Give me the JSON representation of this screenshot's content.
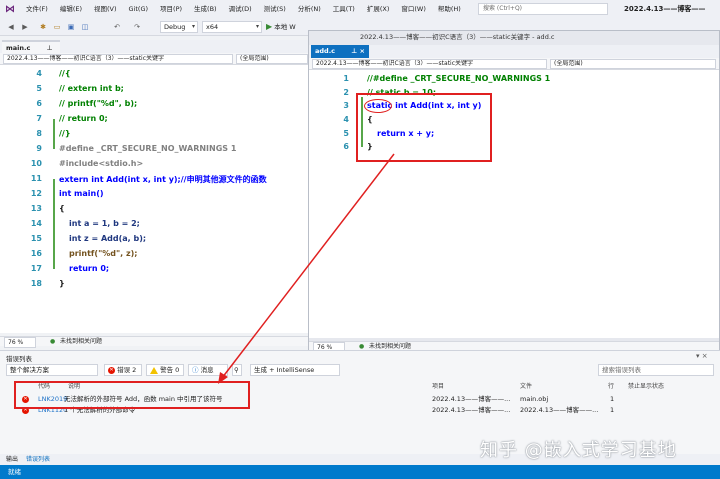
{
  "menu": {
    "items": [
      "文件(F)",
      "编辑(E)",
      "视图(V)",
      "Git(G)",
      "项目(P)",
      "生成(B)",
      "调试(D)",
      "测试(S)",
      "分析(N)",
      "工具(T)",
      "扩展(X)",
      "窗口(W)",
      "帮助(H)"
    ],
    "search_placeholder": "搜索 (Ctrl+Q)",
    "window_title": "2022.4.13——博客——"
  },
  "toolbar": {
    "config": "Debug",
    "platform": "x64",
    "run_label": "本地 W"
  },
  "left_editor": {
    "tab_label": "main.c",
    "tab_pin": "⊥",
    "tab_close": "×",
    "nav_left": "2022.4.13——博客——初识C语言（3）——static关键字",
    "nav_right": "(全局范围)",
    "lines": [
      {
        "n": "4",
        "text": "//{"
      },
      {
        "n": "5",
        "text": "// extern int b;"
      },
      {
        "n": "6",
        "text": "// printf(\"%d\", b);"
      },
      {
        "n": "7",
        "text": "// return 0;"
      },
      {
        "n": "8",
        "text": "//}"
      },
      {
        "n": "9",
        "text": "#define _CRT_SECURE_NO_WARNINGS 1"
      },
      {
        "n": "10",
        "text": "#include<stdio.h>"
      },
      {
        "n": "11",
        "text": "extern int Add(int x, int y);//申明其他源文件的函数"
      },
      {
        "n": "12",
        "text": "int main()"
      },
      {
        "n": "13",
        "text": "{"
      },
      {
        "n": "14",
        "text": "int a = 1, b = 2;"
      },
      {
        "n": "15",
        "text": "int z = Add(a, b);"
      },
      {
        "n": "16",
        "text": "printf(\"%d\", z);"
      },
      {
        "n": "17",
        "text": "return 0;"
      },
      {
        "n": "18",
        "text": "}"
      }
    ],
    "zoom": "76 %",
    "status": "未找到相关问题"
  },
  "right_editor": {
    "tab_label": "add.c",
    "tab_pin": "⊥",
    "tab_close": "×",
    "window_title": "2022.4.13——博客——初识C语言（3）——static关键字 - add.c",
    "nav_left": "2022.4.13——博客——初识C语言（3）——static关键字",
    "nav_right": "(全局范围)",
    "lines": [
      {
        "n": "1",
        "text": "//#define _CRT_SECURE_NO_WARNINGS 1"
      },
      {
        "n": "2",
        "text": "// static b = 10;"
      },
      {
        "n": "3",
        "text": "static int Add(int x, int y)"
      },
      {
        "n": "4",
        "text": "{"
      },
      {
        "n": "5",
        "text": "return x + y;"
      },
      {
        "n": "6",
        "text": "}"
      }
    ],
    "zoom": "76 %",
    "status": "未找到相关问题"
  },
  "error_list": {
    "title": "错误列表",
    "scope": "整个解决方案",
    "errors_btn": "错误 2",
    "warnings_btn": "警告 0",
    "messages_btn": "消息",
    "build_filter": "生成 + IntelliSense",
    "search_placeholder": "搜索错误列表",
    "headers": {
      "code": "代码",
      "desc": "说明",
      "project": "项目",
      "file": "文件",
      "line": "行",
      "suppress": "禁止显示状态"
    },
    "rows": [
      {
        "code": "LNK2019",
        "desc": "无法解析的外部符号 Add，函数 main 中引用了该符号",
        "project": "2022.4.13——博客——...",
        "file": "main.obj",
        "line": "1"
      },
      {
        "code": "LNK1120",
        "desc": "1 个无法解析的外部命令",
        "project": "2022.4.13——博客——...",
        "file": "2022.4.13——博客——...",
        "line": "1"
      }
    ]
  },
  "bottom_tabs": [
    "输出",
    "错误列表"
  ],
  "status_bar": "就绪",
  "watermark": "知乎 @嵌入式学习基地",
  "colors": {
    "accent": "#007acc",
    "annotation": "#e02020",
    "error": "#e51400"
  }
}
